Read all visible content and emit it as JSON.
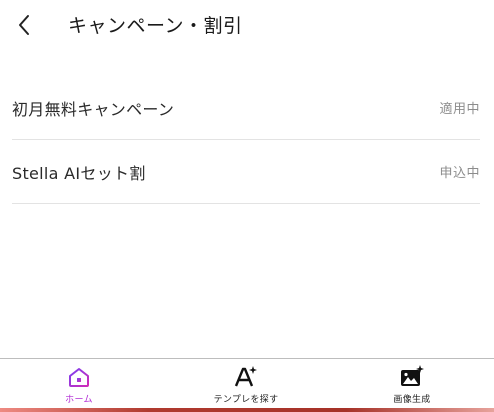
{
  "header": {
    "title": "キャンペーン・割引"
  },
  "campaigns": [
    {
      "label": "初月無料キャンペーン",
      "status": "適用中"
    },
    {
      "label": "Stella AIセット割",
      "status": "申込中"
    }
  ],
  "nav": {
    "items": [
      {
        "label": "ホーム",
        "icon": "home-icon",
        "active": true
      },
      {
        "label": "テンプレを探す",
        "icon": "text-sparkle-icon",
        "active": false
      },
      {
        "label": "画像生成",
        "icon": "image-sparkle-icon",
        "active": false
      }
    ]
  },
  "colors": {
    "accent": "#b12ad4"
  }
}
